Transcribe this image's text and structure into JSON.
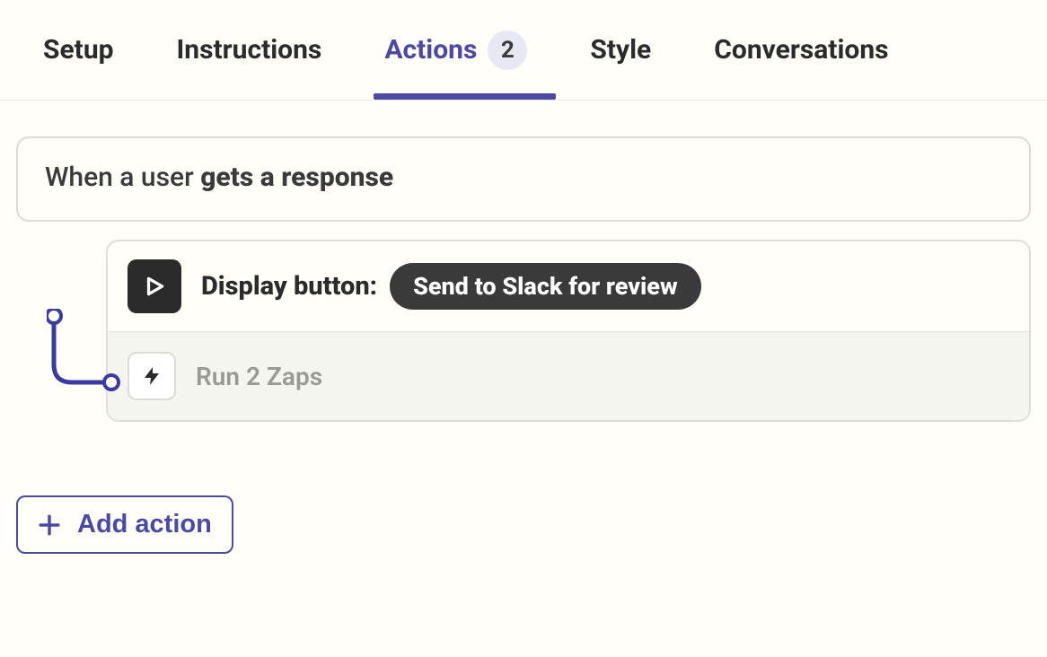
{
  "tabs": {
    "setup": "Setup",
    "instructions": "Instructions",
    "actions": "Actions",
    "actions_count": "2",
    "style": "Style",
    "conversations": "Conversations"
  },
  "trigger": {
    "prefix": "When a user ",
    "bold": "gets a response"
  },
  "action": {
    "label_prefix": "Display button:",
    "button_text": "Send to Slack for review",
    "sub_label": "Run 2 Zaps"
  },
  "add_action_label": "Add action"
}
